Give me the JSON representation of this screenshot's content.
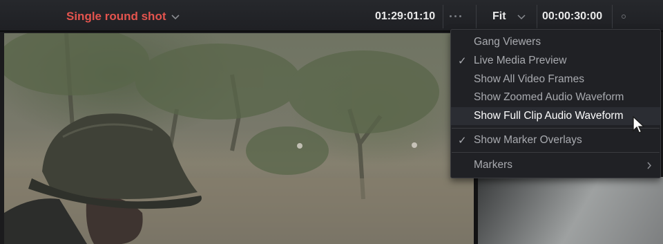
{
  "header": {
    "clip_name": "Single round shot",
    "source_timecode": "01:29:01:10",
    "zoom": "Fit",
    "duration_timecode": "00:00:30:00"
  },
  "menu": {
    "items": [
      {
        "label": "Gang Viewers",
        "checked": false
      },
      {
        "label": "Live Media Preview",
        "checked": true
      },
      {
        "label": "Show All Video Frames",
        "checked": false
      },
      {
        "label": "Show Zoomed Audio Waveform",
        "checked": false
      },
      {
        "label": "Show Full Clip Audio Waveform",
        "checked": false,
        "highlighted": true
      },
      {
        "label": "Show Marker Overlays",
        "checked": true
      },
      {
        "label": "Markers",
        "submenu": true
      }
    ],
    "check_glyph": "✓"
  },
  "colors": {
    "clip_name": "#e3544e",
    "menu_bg": "#202125",
    "menu_text": "#a9abb0",
    "highlight_text": "#ffffff"
  }
}
